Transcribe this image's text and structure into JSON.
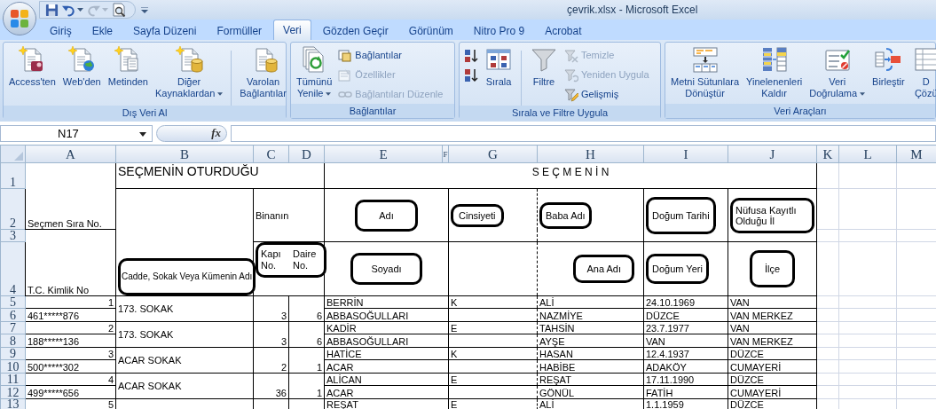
{
  "window": {
    "title": "çevrik.xlsx - Microsoft Excel"
  },
  "tabs": [
    {
      "label": "Giriş",
      "selected": false
    },
    {
      "label": "Ekle",
      "selected": false
    },
    {
      "label": "Sayfa Düzeni",
      "selected": false
    },
    {
      "label": "Formüller",
      "selected": false
    },
    {
      "label": "Veri",
      "selected": true
    },
    {
      "label": "Gözden Geçir",
      "selected": false
    },
    {
      "label": "Görünüm",
      "selected": false
    },
    {
      "label": "Nitro Pro 9",
      "selected": false
    },
    {
      "label": "Acrobat",
      "selected": false
    }
  ],
  "ribbon": [
    {
      "label": "Dış Veri Al",
      "items": [
        {
          "kind": "large",
          "lines": [
            "Access'ten"
          ],
          "dropdown": false
        },
        {
          "kind": "large",
          "lines": [
            "Web'den"
          ],
          "dropdown": false
        },
        {
          "kind": "large",
          "lines": [
            "Metinden"
          ],
          "dropdown": false
        },
        {
          "kind": "large",
          "lines": [
            "Diğer",
            "Kaynaklardan"
          ],
          "dropdown": true
        },
        {
          "kind": "separator"
        },
        {
          "kind": "large",
          "lines": [
            "Varolan",
            "Bağlantılar"
          ],
          "dropdown": false
        }
      ]
    },
    {
      "label": "Bağlantılar",
      "items": [
        {
          "kind": "large",
          "lines": [
            "Tümünü",
            "Yenile"
          ],
          "dropdown": true
        },
        {
          "kind": "stack",
          "items": [
            {
              "label": "Bağlantılar",
              "disabled": false
            },
            {
              "label": "Özellikler",
              "disabled": true
            },
            {
              "label": "Bağlantıları Düzenle",
              "disabled": true
            }
          ]
        }
      ]
    },
    {
      "label": "Sırala ve Filtre Uygula",
      "items": [
        {
          "kind": "stack",
          "items": [
            {
              "disabled": false
            },
            {
              "disabled": false
            }
          ]
        },
        {
          "kind": "large",
          "lines": [
            "Sırala"
          ],
          "dropdown": false
        },
        {
          "kind": "separator"
        },
        {
          "kind": "large",
          "lines": [
            "Filtre"
          ],
          "dropdown": false
        },
        {
          "kind": "stack",
          "items": [
            {
              "label": "Temizle",
              "disabled": true
            },
            {
              "label": "Yeniden Uygula",
              "disabled": true
            },
            {
              "label": "Gelişmiş",
              "disabled": false
            }
          ]
        }
      ]
    },
    {
      "label": "Veri Araçları",
      "items": [
        {
          "kind": "large",
          "lines": [
            "Metni Sütunlara",
            "Dönüştür"
          ],
          "dropdown": false
        },
        {
          "kind": "large",
          "lines": [
            "Yinelenenleri",
            "Kaldır"
          ],
          "dropdown": false
        },
        {
          "kind": "large",
          "lines": [
            "Veri",
            "Doğrulama"
          ],
          "dropdown": true
        },
        {
          "kind": "large",
          "lines": [
            "Birleştir"
          ],
          "dropdown": false
        },
        {
          "kind": "large",
          "lines": [
            "D",
            "Çözü"
          ],
          "dropdown": false
        }
      ]
    }
  ],
  "formula_bar": {
    "name_box": "N17",
    "function_button": "fx"
  },
  "sheet": {
    "columns": [
      "A",
      "B",
      "C",
      "D",
      "E",
      "F",
      "G",
      "H",
      "I",
      "J",
      "K",
      "L",
      "M"
    ],
    "rows": [
      "1",
      "2",
      "3",
      "4",
      "5",
      "6",
      "7",
      "8",
      "9",
      "10",
      "11",
      "12",
      "13"
    ],
    "header": {
      "residence_group": "SEÇMENİN OTURDUĞU",
      "elector_group": "S E Ç M E N İ N",
      "seq_no": {
        "text": "Seçmen Sıra No.",
        "circled": false
      },
      "tc_no": {
        "text": "T.C. Kimlik No",
        "circled": false
      },
      "street": {
        "text": "Cadde, Sokak Veya Kümenin Adı",
        "circled": true
      },
      "building": {
        "text": "Binanın",
        "circled": false
      },
      "door_apartment": {
        "door": "Kapı No.",
        "apartment": "Daire No.",
        "circled": true
      },
      "first_name": {
        "text": "Adı",
        "circled": true
      },
      "gender": {
        "text": "Cinsiyeti",
        "circled": true
      },
      "father": {
        "text": "Baba Adı",
        "circled": true
      },
      "birth_date": {
        "text": "Doğum Tarihi",
        "circled": true
      },
      "province": {
        "text": "Nüfusa Kayıtlı Olduğu İl",
        "circled": true
      },
      "surname": {
        "text": "Soyadı",
        "circled": true
      },
      "mother": {
        "text": "Ana Adı",
        "circled": true
      },
      "birthplace": {
        "text": "Doğum Yeri",
        "circled": true
      },
      "district": {
        "text": "İlçe",
        "circled": true
      }
    },
    "voters": [
      {
        "seq": "1",
        "tc": "461*****876",
        "street": "173. SOKAK",
        "door": "3",
        "apartment": "6",
        "first_name": "BERRİN",
        "gender": "K",
        "father": "ALİ",
        "birth_date": "24.10.1969",
        "province": "VAN",
        "surname": "ABBASOĞULLARI",
        "mother": "NAZMİYE",
        "birthplace": "DÜZCE",
        "district": "VAN MERKEZ"
      },
      {
        "seq": "2",
        "tc": "188*****136",
        "street": "173. SOKAK",
        "door": "3",
        "apartment": "6",
        "first_name": "KADİR",
        "gender": "E",
        "father": "TAHSİN",
        "birth_date": "23.7.1977",
        "province": "VAN",
        "surname": "ABBASOĞULLARI",
        "mother": "AYŞE",
        "birthplace": "VAN",
        "district": "VAN MERKEZ"
      },
      {
        "seq": "3",
        "tc": "500*****302",
        "street": "ACAR SOKAK",
        "door": "2",
        "apartment": "1",
        "first_name": "HATİCE",
        "gender": "K",
        "father": "HASAN",
        "birth_date": "12.4.1937",
        "province": "DÜZCE",
        "surname": "ACAR",
        "mother": "HABİBE",
        "birthplace": "ADAKÖY",
        "district": "CUMAYERİ"
      },
      {
        "seq": "4",
        "tc": "499*****656",
        "street": "ACAR SOKAK",
        "door": "36",
        "apartment": "1",
        "first_name": "ALİCAN",
        "gender": "E",
        "father": "REŞAT",
        "birth_date": "17.11.1990",
        "province": "DÜZCE",
        "surname": "ACAR",
        "mother": "GÖNÜL",
        "birthplace": "FATİH",
        "district": "CUMAYERİ"
      },
      {
        "seq": "5",
        "first_name": "REŞAT",
        "gender": "E",
        "father": "ALİ",
        "birth_date": "1.1.1959",
        "province": "DÜZCE"
      }
    ]
  }
}
